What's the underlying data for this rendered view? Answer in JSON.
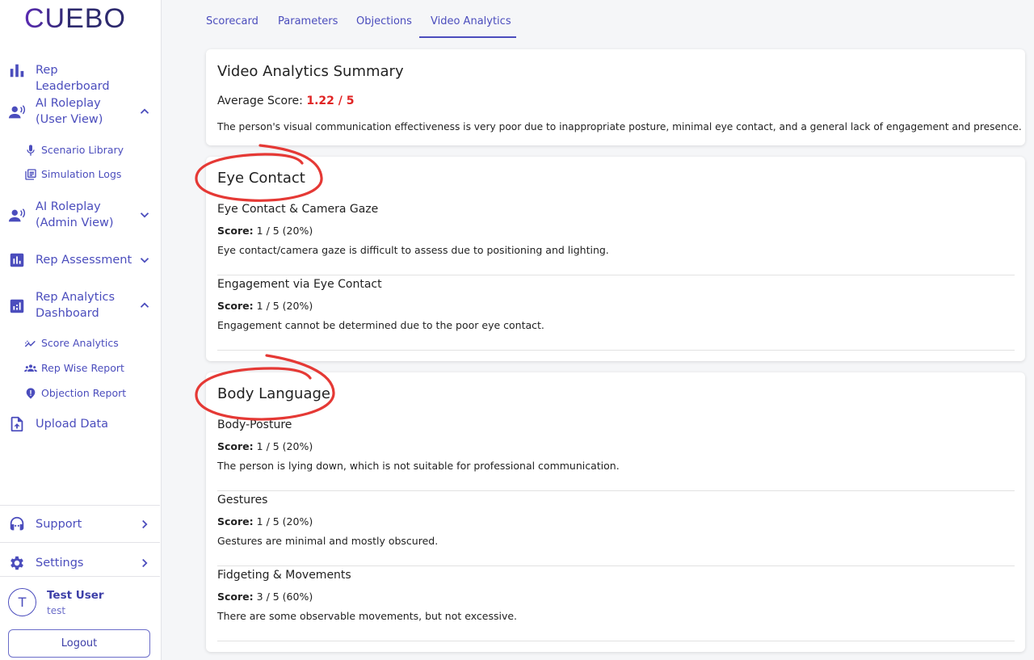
{
  "brand": {
    "logo_text": "CUEBO"
  },
  "sidebar": {
    "items": [
      {
        "label": "Rep Leaderboard",
        "icon": "bar-chart-icon",
        "chevron": ""
      },
      {
        "label": "AI Roleplay (User View)",
        "icon": "voice-user-icon",
        "chevron": "up"
      },
      {
        "label": "AI Roleplay (Admin View)",
        "icon": "voice-user-icon",
        "chevron": "down"
      },
      {
        "label": "Rep Assessment",
        "icon": "assessment-icon",
        "chevron": "down"
      },
      {
        "label": "Rep Analytics Dashboard",
        "icon": "analytics-icon",
        "chevron": "up"
      },
      {
        "label": "Upload Data",
        "icon": "upload-file-icon",
        "chevron": ""
      }
    ],
    "user_view_sub": [
      {
        "label": "Scenario Library",
        "icon": "mic-icon"
      },
      {
        "label": "Simulation Logs",
        "icon": "library-icon"
      }
    ],
    "analytics_sub": [
      {
        "label": "Score Analytics",
        "icon": "trend-icon"
      },
      {
        "label": "Rep Wise Report",
        "icon": "group-icon"
      },
      {
        "label": "Objection Report",
        "icon": "shield-alert-icon"
      }
    ],
    "support_label": "Support",
    "settings_label": "Settings",
    "user": {
      "initial": "T",
      "name": "Test User",
      "handle": "test"
    },
    "logout_label": "Logout"
  },
  "tabs": [
    "Scorecard",
    "Parameters",
    "Objections",
    "Video Analytics"
  ],
  "active_tab": "Video Analytics",
  "summary": {
    "title": "Video Analytics Summary",
    "avg_label": "Average Score:",
    "avg_value": "1.22 / 5",
    "text": "The person's visual communication effectiveness is very poor due to inappropriate posture, minimal eye contact, and a general lack of engagement and presence."
  },
  "sections": [
    {
      "title": "Eye Contact",
      "params": [
        {
          "name": "Eye Contact & Camera Gaze",
          "score_label": "Score:",
          "score": "1 / 5 (20%)",
          "desc": "Eye contact/camera gaze is difficult to assess due to positioning and lighting."
        },
        {
          "name": "Engagement via Eye Contact",
          "score_label": "Score:",
          "score": "1 / 5 (20%)",
          "desc": "Engagement cannot be determined due to the poor eye contact."
        }
      ]
    },
    {
      "title": "Body Language",
      "params": [
        {
          "name": "Body-Posture",
          "score_label": "Score:",
          "score": "1 / 5 (20%)",
          "desc": "The person is lying down, which is not suitable for professional communication."
        },
        {
          "name": "Gestures",
          "score_label": "Score:",
          "score": "1 / 5 (20%)",
          "desc": "Gestures are minimal and mostly obscured."
        },
        {
          "name": "Fidgeting & Movements",
          "score_label": "Score:",
          "score": "3 / 5 (60%)",
          "desc": "There are some observable movements, but not excessive."
        }
      ]
    }
  ],
  "colors": {
    "accent": "#4b4dbd",
    "score_red": "#e02424",
    "annotation": "#e53935"
  }
}
